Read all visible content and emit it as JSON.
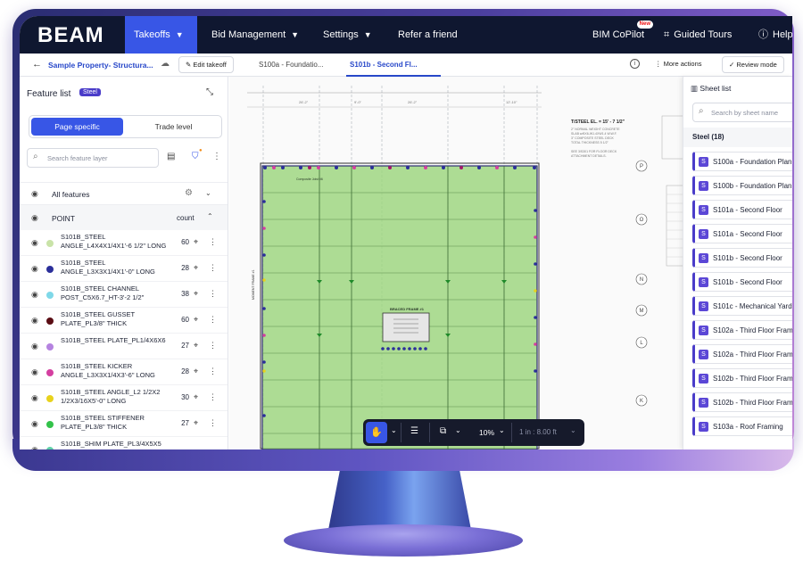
{
  "nav": {
    "logo": "BEAM",
    "items": [
      {
        "label": "Takeoffs",
        "active": true
      },
      {
        "label": "Bid Management"
      },
      {
        "label": "Settings"
      },
      {
        "label": "Refer a friend"
      }
    ],
    "copilot": {
      "label": "BIM CoPilot",
      "badge": "New"
    },
    "guided_tours": "Guided Tours",
    "help": "Help"
  },
  "subheader": {
    "breadcrumb": "Sample Property- Structura...",
    "edit_takeoff": "Edit takeoff",
    "page_tabs": [
      {
        "label": "S100a - Foundatio..."
      },
      {
        "label": "S101b - Second Fl...",
        "active": true
      }
    ],
    "more_actions": "More actions",
    "review_mode": "Review mode"
  },
  "feature_list": {
    "title": "Feature list",
    "badge": "Steel",
    "segments": {
      "page_specific": "Page specific",
      "trade_level": "Trade level"
    },
    "search_placeholder": "Search feature layer",
    "all_features": "All features",
    "group": {
      "name": "POINT",
      "count_label": "count"
    },
    "rows": [
      {
        "label": "S101B_STEEL ANGLE_L4X4X1/4X1'-6 1/2\" LONG",
        "count": "60",
        "color": "#c9e3a8"
      },
      {
        "label": "S101B_STEEL ANGLE_L3X3X1/4X1'-0\" LONG",
        "count": "28",
        "color": "#2b2f9a"
      },
      {
        "label": "S101B_STEEL CHANNEL POST_C5X6.7_HT-3'-2 1/2\"",
        "count": "38",
        "color": "#7fd8e8"
      },
      {
        "label": "S101B_STEEL GUSSET PLATE_PL3/8\" THICK",
        "count": "60",
        "color": "#5a0d14"
      },
      {
        "label": "S101B_STEEL PLATE_PL1/4X6X6",
        "count": "27",
        "color": "#b583e0"
      },
      {
        "label": "S101B_STEEL KICKER ANGLE_L3X3X1/4X3'-6\" LONG",
        "count": "28",
        "color": "#d43fa0"
      },
      {
        "label": "S101B_STEEL ANGLE_L2 1/2X2 1/2X3/16X5'-0\" LONG",
        "count": "30",
        "color": "#e8d21c"
      },
      {
        "label": "S101B_STEEL STIFFENER PLATE_PL3/8\" THICK",
        "count": "27",
        "color": "#33c24a"
      },
      {
        "label": "S101B_SHIM PLATE_PL3/4X5X5",
        "count": "",
        "color": "#5fd1a8"
      }
    ]
  },
  "sheet_list": {
    "title": "Sheet list",
    "search_placeholder": "Search by sheet name",
    "group": "Steel (18)",
    "sheets": [
      "S100a - Foundation Plan",
      "S100b - Foundation Plan",
      "S101a - Second Floor",
      "S101a - Second Floor",
      "S101b - Second Floor",
      "S101b - Second Floor",
      "S101c - Mechanical Yard",
      "S102a - Third Floor Framing",
      "S102a - Third Floor Framing",
      "S102b - Third Floor Framing",
      "S102b - Third Floor Framing",
      "S103a - Roof Framing"
    ]
  },
  "drawing": {
    "elevation_note": "T/STEEL EL. = 15' - 7 1/2\"",
    "braced_frame": "BRACED FRAME #1",
    "moment_frame": "MOMENT FRAME #1",
    "composite_joist": "Composite Joist #6",
    "grid_letters": [
      "P",
      "O",
      "N",
      "M",
      "L",
      "K"
    ]
  },
  "toolbar": {
    "zoom": "10%",
    "scale": "1 in : 8.00 ft"
  },
  "colors": {
    "accent": "#3856e6",
    "nav_bg": "#0f1730",
    "steel_badge": "#4a3cc9",
    "drawing_fill": "#9ad57a"
  }
}
